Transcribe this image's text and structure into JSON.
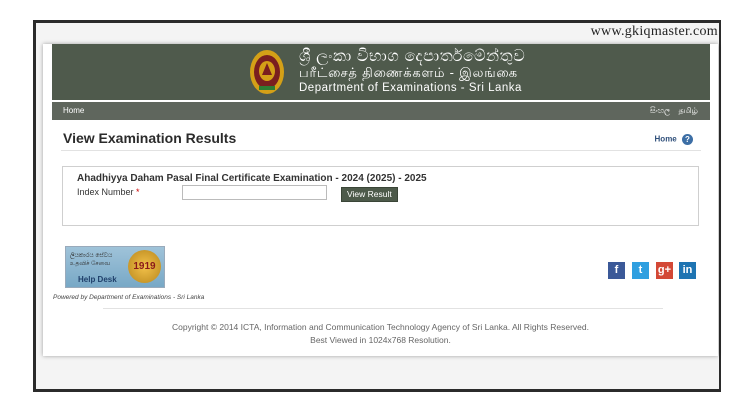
{
  "watermark": "www.gkiqmaster.com",
  "header": {
    "line_sinhala": "ශ්‍රී ලංකා විභාග දෙපාර්තමේන්තුව",
    "line_tamil": "பரீட்சைத் திணைக்களம் - இலங்கை",
    "line_english": "Department of Examinations - Sri Lanka",
    "emblem": "sri-lanka-emblem"
  },
  "nav": {
    "home": "Home",
    "lang_sinhala": "සිංහල",
    "lang_tamil": "தமிழ்"
  },
  "main": {
    "title": "View Examination Results",
    "home_link": "Home",
    "help_icon": "?"
  },
  "exam": {
    "title": "Ahadhiyya Daham Pasal Final Certificate Examination - 2024 (2025) - 2025",
    "index_label": "Index Number",
    "required_mark": "*",
    "index_value": "",
    "button": "View Result"
  },
  "helpdesk": {
    "text1": "ලියකාරය සේවය",
    "text2": "உதவிச் சேவை",
    "label": "Help Desk",
    "number": "1919"
  },
  "social": {
    "facebook": "f",
    "twitter": "t",
    "googleplus": "g+",
    "linkedin": "in"
  },
  "footer": {
    "powered": "Powered by Department of Examinations - Sri Lanka",
    "copyright": "Copyright © 2014 ICTA, Information and Communication Technology Agency of Sri Lanka. All Rights Reserved.",
    "resolution": "Best Viewed in 1024x768 Resolution."
  },
  "colors": {
    "header_bg": "#4f5a4c",
    "nav_bg": "#5f665d",
    "button_bg": "#4d5a4a"
  }
}
